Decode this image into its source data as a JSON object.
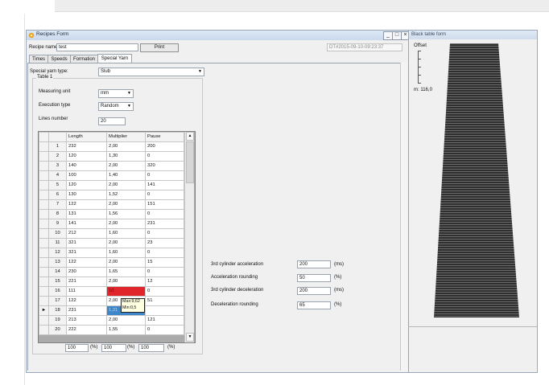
{
  "main_window": {
    "title": "Recipes Form",
    "recipe_name_label": "Recipe name:",
    "recipe_name_value": "test",
    "print_button": "Print",
    "timestamp": "DT#2015-09-10-09:23:37",
    "tabs": [
      "Times",
      "Speeds",
      "Formation",
      "Special Yarn"
    ],
    "active_tab": "Special Yarn",
    "special_yarn_type_label": "Special yarn type:",
    "special_yarn_type_value": "Slub",
    "table_group": {
      "label": "Table 1",
      "measuring_unit_label": "Measuring unit",
      "measuring_unit_value": "mm",
      "execution_type_label": "Execution type",
      "execution_type_value": "Random",
      "lines_number_label": "Lines number",
      "lines_number_value": "20"
    },
    "grid": {
      "columns": [
        "Length",
        "Multiplier",
        "Pause"
      ],
      "rows": [
        {
          "n": "1",
          "length": "232",
          "multiplier": "2,00",
          "pause": "200"
        },
        {
          "n": "2",
          "length": "120",
          "multiplier": "1,30",
          "pause": "0"
        },
        {
          "n": "3",
          "length": "140",
          "multiplier": "2,00",
          "pause": "320"
        },
        {
          "n": "4",
          "length": "100",
          "multiplier": "1,40",
          "pause": "0"
        },
        {
          "n": "5",
          "length": "120",
          "multiplier": "2,00",
          "pause": "141"
        },
        {
          "n": "6",
          "length": "130",
          "multiplier": "1,52",
          "pause": "0"
        },
        {
          "n": "7",
          "length": "122",
          "multiplier": "2,00",
          "pause": "151"
        },
        {
          "n": "8",
          "length": "131",
          "multiplier": "1,56",
          "pause": "0"
        },
        {
          "n": "9",
          "length": "141",
          "multiplier": "2,00",
          "pause": "231"
        },
        {
          "n": "10",
          "length": "212",
          "multiplier": "1,60",
          "pause": "0"
        },
        {
          "n": "11",
          "length": "321",
          "multiplier": "2,00",
          "pause": "23"
        },
        {
          "n": "12",
          "length": "321",
          "multiplier": "1,60",
          "pause": "0"
        },
        {
          "n": "13",
          "length": "122",
          "multiplier": "2,00",
          "pause": "15"
        },
        {
          "n": "14",
          "length": "230",
          "multiplier": "1,65",
          "pause": "0"
        },
        {
          "n": "15",
          "length": "221",
          "multiplier": "2,00",
          "pause": "12"
        },
        {
          "n": "16",
          "length": "111",
          "multiplier": "10",
          "pause": "0"
        },
        {
          "n": "17",
          "length": "122",
          "multiplier": "2,00",
          "pause": "51"
        },
        {
          "n": "18",
          "length": "231",
          "multiplier": "1,21",
          "pause": ""
        },
        {
          "n": "19",
          "length": "213",
          "multiplier": "2,00",
          "pause": "121"
        },
        {
          "n": "20",
          "length": "222",
          "multiplier": "1,55",
          "pause": "0"
        }
      ],
      "current_row_marker": "►",
      "tooltip_max": "Max:9,62",
      "tooltip_min": "Min:0,5",
      "error_cell_color": "#e0262b",
      "selected_cell_color": "#3d86c9"
    },
    "percent_boxes": [
      {
        "value": "100",
        "unit": "(%)"
      },
      {
        "value": "100",
        "unit": "(%)"
      },
      {
        "value": "100",
        "unit": "(%)"
      }
    ],
    "params": [
      {
        "label": "3rd cylinder acceleration",
        "value": "200",
        "unit": "(ms)"
      },
      {
        "label": "Acceleration rounding",
        "value": "50",
        "unit": "(%)"
      },
      {
        "label": "3rd cylinder deceleration",
        "value": "200",
        "unit": "(ms)"
      },
      {
        "label": "Deceleration rounding",
        "value": "65",
        "unit": "(%)"
      }
    ],
    "window_controls": {
      "minimize": "_",
      "maximize": "□",
      "close": "×"
    }
  },
  "side_panel": {
    "title": "Black table form",
    "offset_label": "Offset",
    "m_value": "m: 116,0",
    "bar_color": "#2b2b2b"
  }
}
